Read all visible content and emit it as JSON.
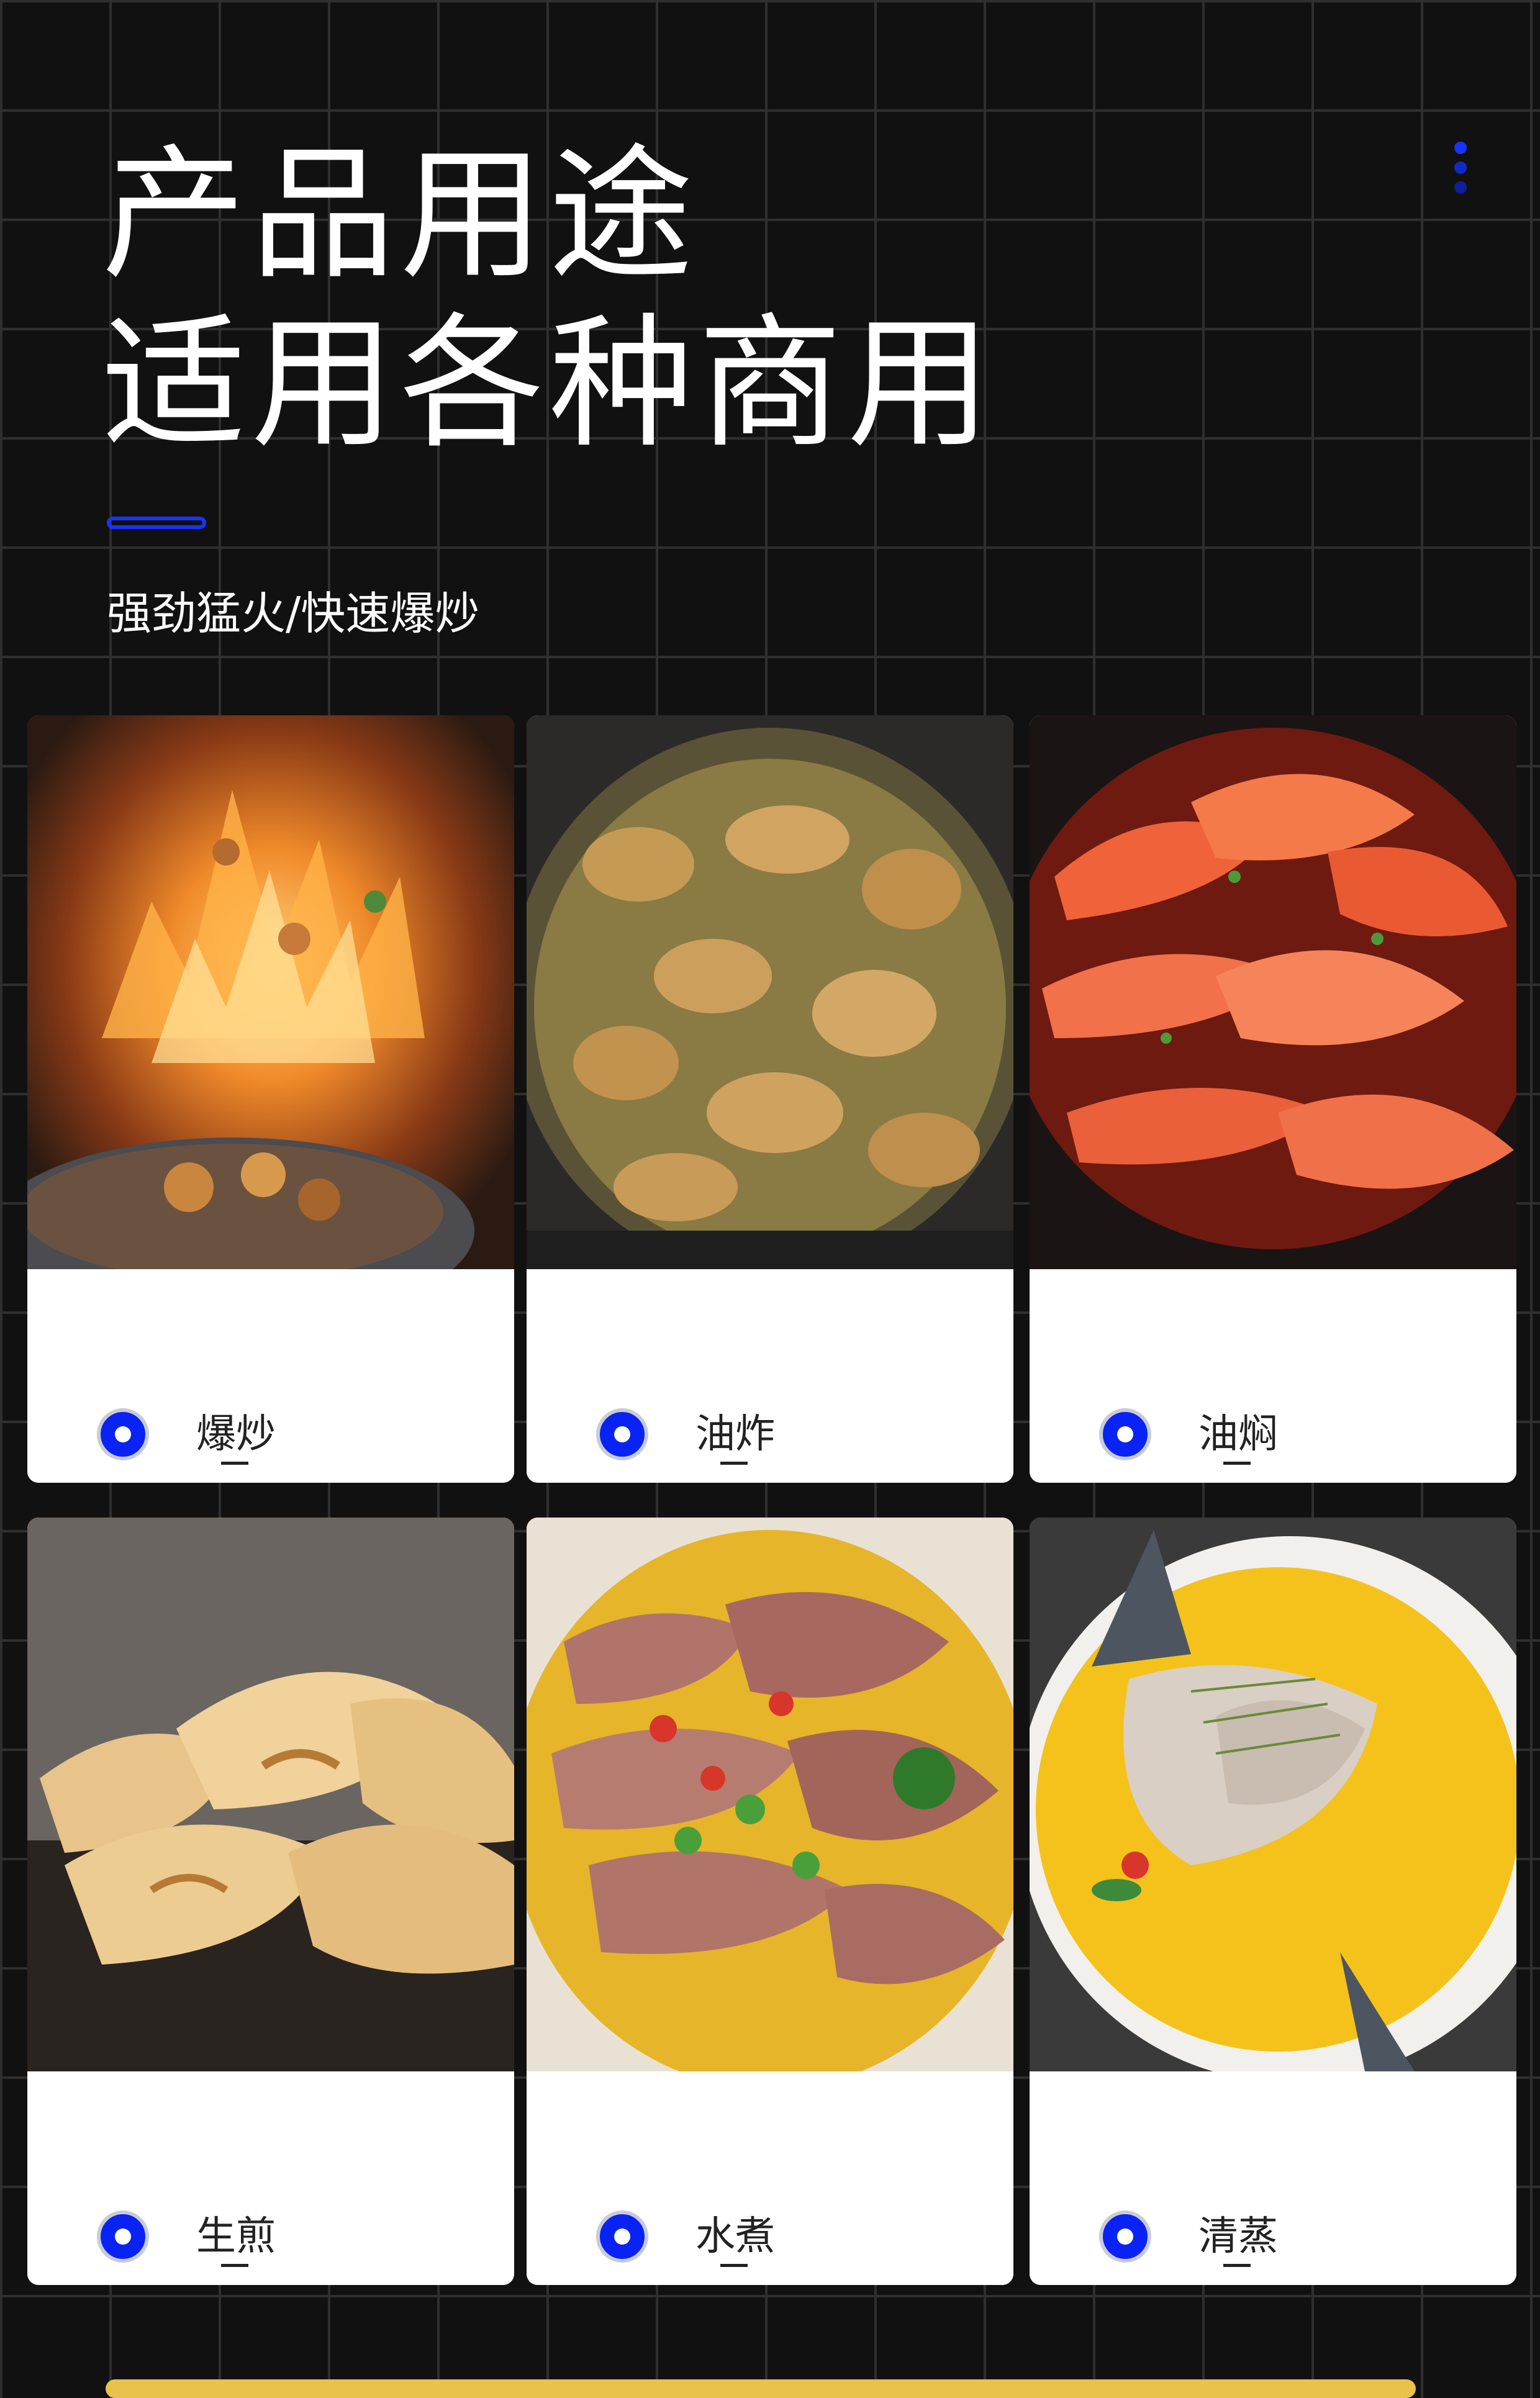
{
  "header": {
    "title_line1": "产品用途",
    "title_line2": "适用各种商用",
    "subtitle": "强劲猛火/快速爆炒"
  },
  "colors": {
    "background": "#111111",
    "grid_line": "#2f2f2f",
    "accent": "#1733ff",
    "card": "#ffffff",
    "label_text": "#222222"
  },
  "cards": [
    {
      "label": "爆炒",
      "icon": "radio-selected-icon",
      "photo": "flaming-wok-stir-fry"
    },
    {
      "label": "油炸",
      "icon": "radio-selected-icon",
      "photo": "deep-fried-chicken-in-oil"
    },
    {
      "label": "油焖",
      "icon": "radio-selected-icon",
      "photo": "braised-shrimp"
    },
    {
      "label": "生煎",
      "icon": "radio-selected-icon",
      "photo": "pan-fried-dumplings"
    },
    {
      "label": "水煮",
      "icon": "radio-selected-icon",
      "photo": "boiled-sliced-meat-with-chili"
    },
    {
      "label": "清蒸",
      "icon": "radio-selected-icon",
      "photo": "steamed-fish-in-broth"
    }
  ]
}
